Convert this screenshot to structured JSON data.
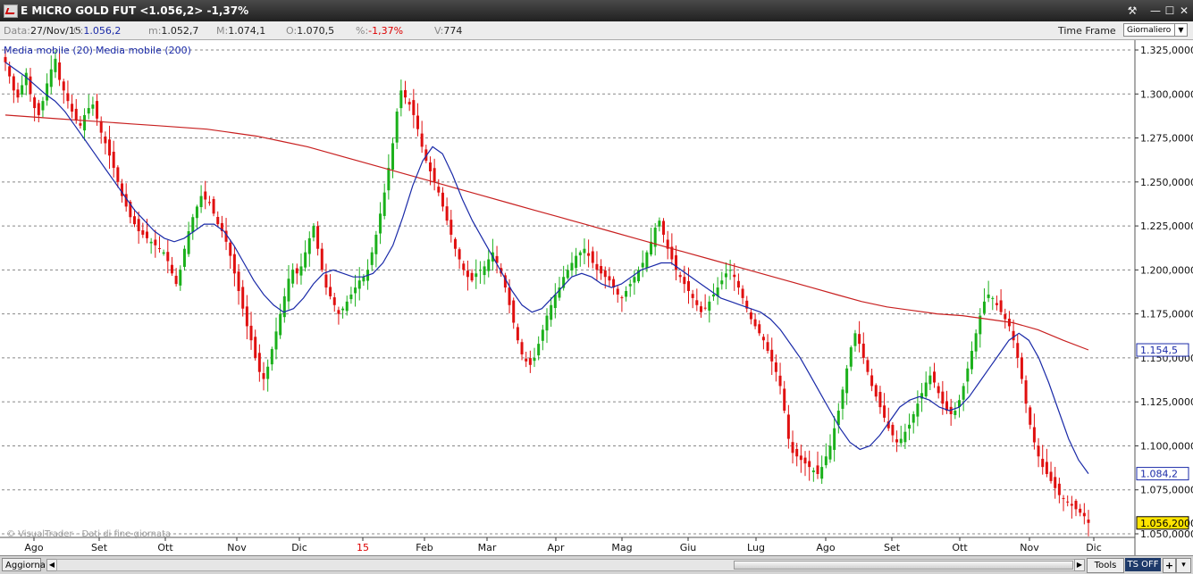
{
  "window": {
    "title": "E MICRO GOLD FUT <1.056,2> -1,37%",
    "buttons": {
      "tools": "⚒",
      "minimize": "—",
      "maximize": "☐",
      "close": "✕"
    }
  },
  "infobar": {
    "date_label": "Data:",
    "date_value": "27/Nov/15",
    "close_label": "C:",
    "close_value": "1.056,2",
    "min_label": "m:",
    "min_value": "1.052,7",
    "max_label": "M:",
    "max_value": "1.074,1",
    "open_label": "O:",
    "open_value": "1.070,5",
    "pct_label": "%:",
    "pct_value": "-1,37%",
    "vol_label": "V:",
    "vol_value": "774",
    "timeframe_label": "Time Frame",
    "period_value": "Giornaliero"
  },
  "legend": {
    "ma20": "Media mobile (20)",
    "ma200": "Media mobile (200)"
  },
  "watermark": "© VisualTrader - Dati di fine giornata",
  "chart_data": {
    "type": "candlestick",
    "instrument": "E MICRO GOLD FUT",
    "y_ticks": [
      "1.325,0000",
      "1.300,0000",
      "1.275,0000",
      "1.250,0000",
      "1.225,0000",
      "1.200,0000",
      "1.175,0000",
      "1.150,0000",
      "1.125,0000",
      "1.100,0000",
      "1.075,0000",
      "1.050,0000"
    ],
    "ylim": [
      1050,
      1325
    ],
    "x_ticks": [
      "Ago",
      "Set",
      "Ott",
      "Nov",
      "Dic",
      "15",
      "Feb",
      "Mar",
      "Apr",
      "Mag",
      "Giu",
      "Lug",
      "Ago",
      "Set",
      "Ott",
      "Nov",
      "Dic"
    ],
    "last_price_label": "1.056,2000",
    "ma_labels": {
      "ma20_last": "1.084,2",
      "ma200_last": "1.154,5"
    },
    "close_series": [
      1318,
      1310,
      1302,
      1298,
      1305,
      1312,
      1300,
      1292,
      1288,
      1296,
      1306,
      1314,
      1320,
      1308,
      1302,
      1296,
      1290,
      1285,
      1282,
      1288,
      1292,
      1294,
      1286,
      1278,
      1272,
      1265,
      1258,
      1250,
      1242,
      1236,
      1230,
      1226,
      1222,
      1220,
      1218,
      1216,
      1214,
      1212,
      1210,
      1205,
      1198,
      1192,
      1200,
      1212,
      1222,
      1230,
      1236,
      1242,
      1240,
      1238,
      1232,
      1226,
      1222,
      1216,
      1208,
      1198,
      1188,
      1178,
      1168,
      1160,
      1150,
      1142,
      1138,
      1145,
      1155,
      1165,
      1175,
      1185,
      1195,
      1200,
      1198,
      1202,
      1210,
      1218,
      1225,
      1212,
      1200,
      1190,
      1185,
      1180,
      1175,
      1178,
      1182,
      1186,
      1190,
      1194,
      1196,
      1200,
      1210,
      1220,
      1232,
      1244,
      1258,
      1272,
      1290,
      1302,
      1298,
      1294,
      1288,
      1280,
      1270,
      1262,
      1256,
      1250,
      1244,
      1236,
      1228,
      1220,
      1212,
      1206,
      1200,
      1196,
      1194,
      1198,
      1200,
      1202,
      1206,
      1210,
      1204,
      1198,
      1190,
      1180,
      1170,
      1160,
      1152,
      1148,
      1146,
      1150,
      1158,
      1166,
      1174,
      1180,
      1186,
      1190,
      1196,
      1200,
      1204,
      1208,
      1210,
      1212,
      1208,
      1204,
      1200,
      1198,
      1196,
      1194,
      1190,
      1186,
      1184,
      1188,
      1192,
      1196,
      1200,
      1204,
      1210,
      1216,
      1224,
      1228,
      1220,
      1212,
      1206,
      1200,
      1196,
      1192,
      1188,
      1184,
      1180,
      1176,
      1178,
      1182,
      1186,
      1190,
      1194,
      1198,
      1200,
      1196,
      1190,
      1184,
      1178,
      1172,
      1168,
      1164,
      1160,
      1154,
      1148,
      1142,
      1134,
      1120,
      1104,
      1096,
      1094,
      1092,
      1090,
      1088,
      1086,
      1084,
      1088,
      1094,
      1100,
      1110,
      1120,
      1132,
      1144,
      1156,
      1164,
      1158,
      1150,
      1142,
      1134,
      1128,
      1122,
      1116,
      1110,
      1106,
      1102,
      1104,
      1108,
      1112,
      1118,
      1124,
      1130,
      1136,
      1140,
      1136,
      1130,
      1124,
      1120,
      1118,
      1120,
      1126,
      1134,
      1144,
      1154,
      1164,
      1174,
      1182,
      1186,
      1184,
      1180,
      1176,
      1172,
      1168,
      1160,
      1150,
      1138,
      1124,
      1112,
      1102,
      1094,
      1088,
      1084,
      1080,
      1076,
      1072,
      1070,
      1068,
      1066,
      1064,
      1062,
      1060,
      1056.2
    ],
    "ma20_series": [
      1318,
      1314,
      1310,
      1305,
      1300,
      1296,
      1290,
      1282,
      1274,
      1266,
      1258,
      1250,
      1242,
      1234,
      1228,
      1222,
      1218,
      1216,
      1218,
      1222,
      1226,
      1226,
      1222,
      1214,
      1204,
      1194,
      1186,
      1180,
      1176,
      1178,
      1184,
      1192,
      1198,
      1200,
      1198,
      1196,
      1196,
      1198,
      1204,
      1214,
      1230,
      1248,
      1262,
      1270,
      1266,
      1254,
      1240,
      1228,
      1218,
      1208,
      1198,
      1188,
      1180,
      1176,
      1178,
      1184,
      1190,
      1196,
      1198,
      1196,
      1192,
      1190,
      1192,
      1196,
      1200,
      1202,
      1204,
      1204,
      1200,
      1196,
      1192,
      1188,
      1184,
      1182,
      1180,
      1178,
      1176,
      1172,
      1166,
      1158,
      1150,
      1140,
      1130,
      1120,
      1110,
      1102,
      1098,
      1100,
      1106,
      1114,
      1122,
      1126,
      1128,
      1126,
      1122,
      1120,
      1122,
      1128,
      1136,
      1144,
      1152,
      1160,
      1164,
      1160,
      1150,
      1136,
      1120,
      1104,
      1092,
      1084.2
    ],
    "ma200_series": [
      1288,
      1287,
      1286,
      1285,
      1284,
      1283,
      1282,
      1281,
      1280,
      1278,
      1276,
      1273,
      1270,
      1266,
      1262,
      1258,
      1254,
      1250,
      1246,
      1242,
      1238,
      1234,
      1230,
      1226,
      1222,
      1218,
      1214,
      1210,
      1206,
      1202,
      1198,
      1194,
      1190,
      1186,
      1182,
      1179,
      1177,
      1175,
      1174,
      1172,
      1170,
      1166,
      1160,
      1154.5
    ]
  }
}
